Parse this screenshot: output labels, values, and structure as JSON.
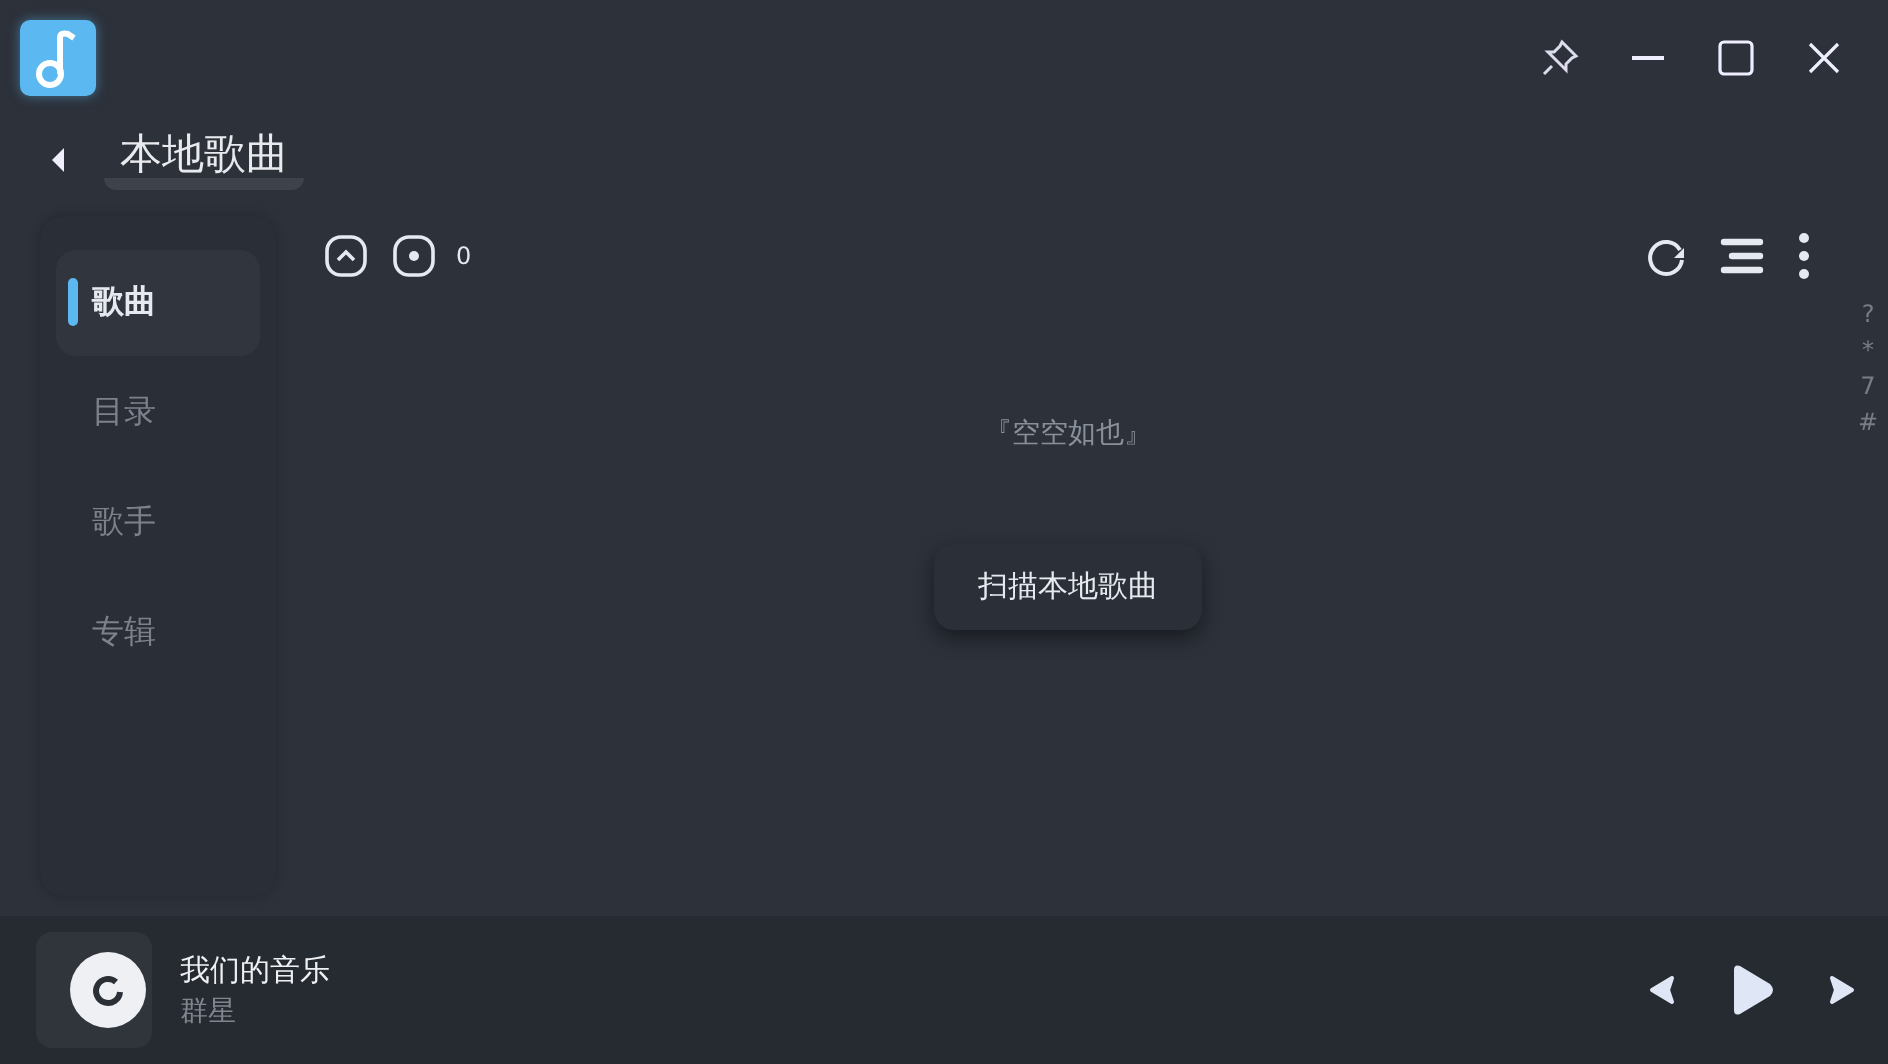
{
  "page": {
    "title": "本地歌曲"
  },
  "tabs": [
    {
      "label": "歌曲",
      "selected": true
    },
    {
      "label": "目录",
      "selected": false
    },
    {
      "label": "歌手",
      "selected": false
    },
    {
      "label": "专辑",
      "selected": false
    }
  ],
  "toolbar": {
    "count": "0"
  },
  "empty": {
    "message": "『空空如也』",
    "button": "扫描本地歌曲"
  },
  "index_letters": [
    "?",
    "*",
    "7",
    "#"
  ],
  "now_playing": {
    "title": "我们的音乐",
    "artist": "群星"
  }
}
